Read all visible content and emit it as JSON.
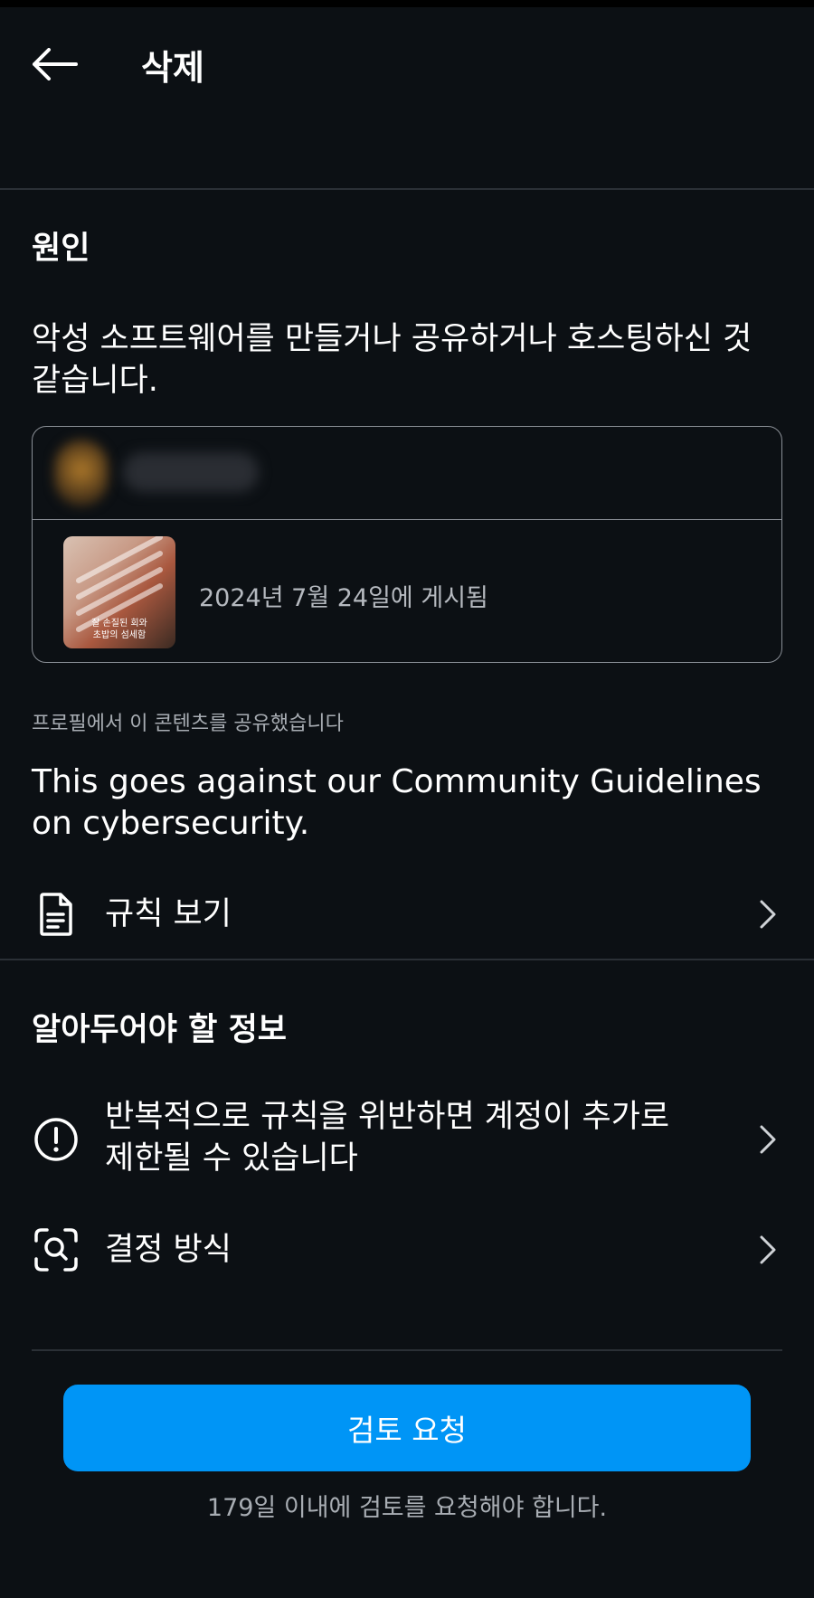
{
  "header": {
    "title": "삭제"
  },
  "reason_section": {
    "title": "원인",
    "text": "악성 소프트웨어를 만들거나 공유하거나 호스팅하신 것 같습니다.",
    "post": {
      "posted_date": "2024년 7월 24일에 게시됨",
      "thumbnail_caption_line1": "잘 손질된 회와",
      "thumbnail_caption_line2": "초밥의 섬세함"
    },
    "shared_note": "프로필에서 이 콘텐츠를 공유했습니다",
    "guideline_text": "This goes against our Community Guidelines on cybersecurity.",
    "rules_link": "규칙 보기"
  },
  "info_section": {
    "title": "알아두어야 할 정보",
    "items": [
      {
        "label": "반복적으로 규칙을 위반하면 계정이 추가로 제한될 수 있습니다",
        "icon": "alert-circle-icon"
      },
      {
        "label": "결정 방식",
        "icon": "scan-search-icon"
      }
    ]
  },
  "footer": {
    "review_button": "검토 요청",
    "deadline": "179일 이내에 검토를 요청해야 합니다."
  },
  "colors": {
    "background": "#0c1014",
    "accent": "#0095f6",
    "divider": "#2b3036",
    "secondary_text": "#a8adb3"
  }
}
